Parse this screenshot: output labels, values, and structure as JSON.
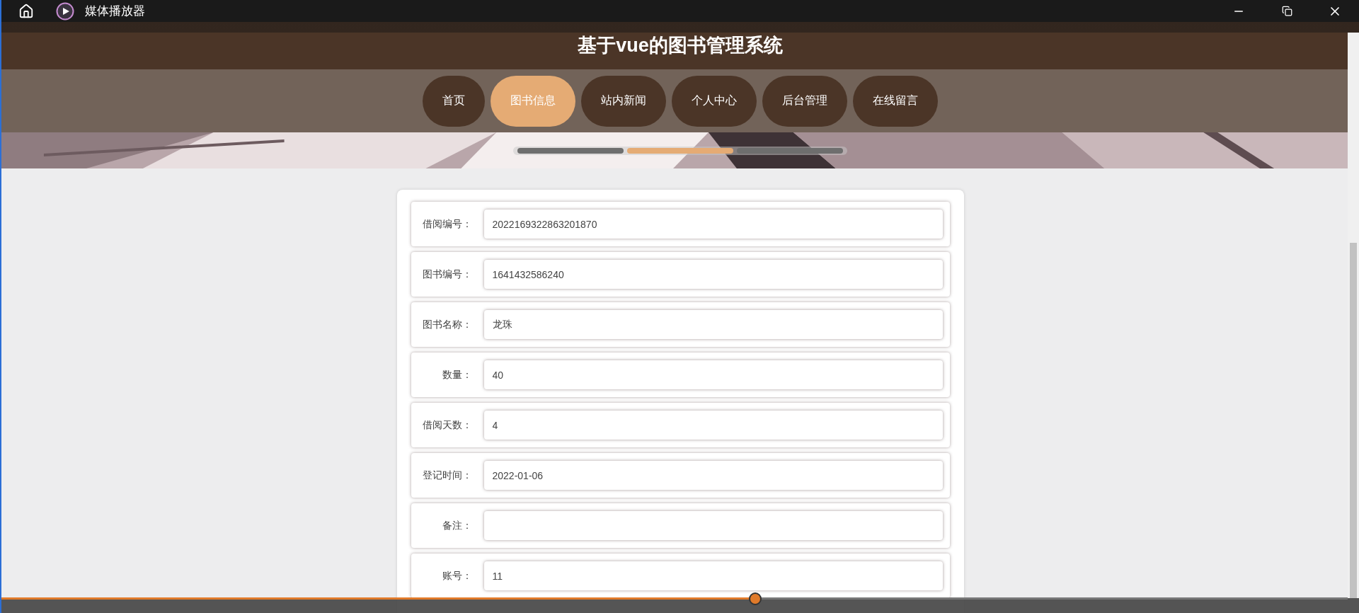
{
  "window": {
    "title": "媒体播放器"
  },
  "site": {
    "title": "基于vue的图书管理系统"
  },
  "nav": [
    {
      "label": "首页",
      "selected": false
    },
    {
      "label": "图书信息",
      "selected": true
    },
    {
      "label": "站内新闻",
      "selected": false
    },
    {
      "label": "个人中心",
      "selected": false
    },
    {
      "label": "后台管理",
      "selected": false
    },
    {
      "label": "在线留言",
      "selected": false
    }
  ],
  "carousel": [
    {
      "selected": false
    },
    {
      "selected": true
    },
    {
      "selected": false
    }
  ],
  "form": [
    {
      "label": "借阅编号：",
      "value": "2022169322863201870"
    },
    {
      "label": "图书编号：",
      "value": "1641432586240"
    },
    {
      "label": "图书名称：",
      "value": "龙珠"
    },
    {
      "label": "数量：",
      "value": "40"
    },
    {
      "label": "借阅天数：",
      "value": "4"
    },
    {
      "label": "登记时间：",
      "value": "2022-01-06"
    },
    {
      "label": "备注："
    },
    {
      "label": "账号：",
      "value": "11"
    }
  ],
  "player": {
    "level": 0.56
  }
}
